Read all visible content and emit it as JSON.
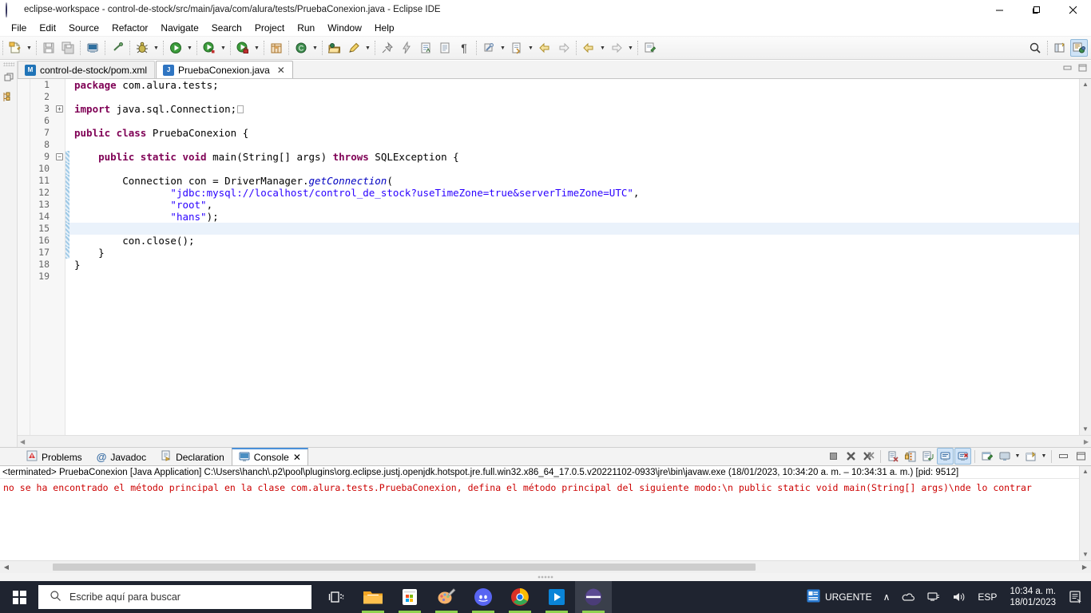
{
  "window": {
    "title": "eclipse-workspace - control-de-stock/src/main/java/com/alura/tests/PruebaConexion.java - Eclipse IDE",
    "app_icon": "eclipse-icon",
    "minimize": "—",
    "maximize": "❐",
    "close": "✕"
  },
  "menubar": {
    "items": [
      {
        "label": "File"
      },
      {
        "label": "Edit"
      },
      {
        "label": "Source"
      },
      {
        "label": "Refactor"
      },
      {
        "label": "Navigate"
      },
      {
        "label": "Search"
      },
      {
        "label": "Project"
      },
      {
        "label": "Run"
      },
      {
        "label": "Window"
      },
      {
        "label": "Help"
      }
    ]
  },
  "toolbar": {
    "buttons": [
      {
        "name": "new-wizard",
        "icon": "new-file-icon",
        "dropdown": true
      },
      {
        "name": "save",
        "icon": "save-icon",
        "dropdown": false
      },
      {
        "name": "save-all",
        "icon": "save-all-icon",
        "dropdown": false
      },
      {
        "name": "print",
        "icon": "print-icon",
        "dropdown": false
      },
      {
        "name": "link",
        "icon": "link-icon",
        "dropdown": false
      },
      {
        "name": "debug",
        "icon": "debug-bug-icon",
        "dropdown": true
      },
      {
        "name": "run",
        "icon": "run-play-icon",
        "dropdown": true
      },
      {
        "name": "coverage",
        "icon": "coverage-icon",
        "dropdown": true
      },
      {
        "name": "profile",
        "icon": "profile-lock-icon",
        "dropdown": true
      },
      {
        "name": "new-java-package",
        "icon": "package-icon",
        "dropdown": false
      },
      {
        "name": "new-class",
        "icon": "new-class-icon",
        "dropdown": true
      },
      {
        "name": "open-type",
        "icon": "open-type-icon",
        "dropdown": false
      },
      {
        "name": "search-pencil",
        "icon": "pencil-icon",
        "dropdown": true
      },
      {
        "name": "pin-editor",
        "icon": "pin-icon",
        "dropdown": false
      },
      {
        "name": "quick-fix",
        "icon": "lightning-icon",
        "dropdown": false
      },
      {
        "name": "toggle-markoccurrences",
        "icon": "document-a-icon",
        "dropdown": false
      },
      {
        "name": "show-whitespace",
        "icon": "document-icon",
        "dropdown": false
      },
      {
        "name": "paragraph-marks",
        "icon": "pilcrow-icon",
        "dropdown": false
      },
      {
        "name": "external-tools",
        "icon": "external-tools-icon",
        "dropdown": true
      },
      {
        "name": "next-annotation",
        "icon": "next-annotation-icon",
        "dropdown": true
      },
      {
        "name": "back",
        "icon": "back-arrow-icon",
        "dropdown": false
      },
      {
        "name": "forward",
        "icon": "forward-arrow-icon",
        "dropdown": false
      },
      {
        "name": "back-history",
        "icon": "back-arrow-yellow-icon",
        "dropdown": true
      },
      {
        "name": "forward-history",
        "icon": "forward-arrow-icon",
        "dropdown": true
      },
      {
        "name": "new-editor",
        "icon": "new-editor-icon",
        "dropdown": false
      }
    ],
    "right": [
      {
        "name": "quick-access-search",
        "icon": "search-icon"
      },
      {
        "name": "open-perspective",
        "icon": "open-perspective-icon"
      },
      {
        "name": "java-perspective",
        "icon": "java-perspective-icon",
        "active": true
      }
    ]
  },
  "leftbar": {
    "icons": [
      {
        "name": "restore-view-icon",
        "glyph": "❐"
      },
      {
        "name": "package-explorer-icon",
        "glyph": "▦"
      }
    ]
  },
  "editor": {
    "tabs": [
      {
        "label": "control-de-stock/pom.xml",
        "icon": "maven-icon",
        "icon_letter": "M",
        "active": false,
        "closable": false
      },
      {
        "label": "PruebaConexion.java",
        "icon": "java-file-icon",
        "icon_letter": "J",
        "active": true,
        "closable": true,
        "close_glyph": "✕"
      }
    ],
    "tab_controls": [
      {
        "name": "minimize-editor-icon",
        "glyph": "━"
      },
      {
        "name": "maximize-editor-icon",
        "glyph": "☐"
      }
    ],
    "lines": [
      {
        "num": "1",
        "fold": null,
        "current": false,
        "method_bar": false,
        "tokens": [
          {
            "t": "kw",
            "v": "package"
          },
          {
            "t": "plain",
            "v": " com.alura.tests;"
          }
        ]
      },
      {
        "num": "2",
        "fold": null,
        "current": false,
        "method_bar": false,
        "tokens": [
          {
            "t": "plain",
            "v": ""
          }
        ]
      },
      {
        "num": "3",
        "fold": "plus",
        "current": false,
        "method_bar": false,
        "tokens": [
          {
            "t": "kw",
            "v": "import"
          },
          {
            "t": "plain",
            "v": " java.sql.Connection;"
          },
          {
            "t": "boxed",
            "v": "·"
          }
        ]
      },
      {
        "num": "6",
        "fold": null,
        "current": false,
        "method_bar": false,
        "tokens": [
          {
            "t": "plain",
            "v": ""
          }
        ]
      },
      {
        "num": "7",
        "fold": null,
        "current": false,
        "method_bar": false,
        "tokens": [
          {
            "t": "kw",
            "v": "public class"
          },
          {
            "t": "plain",
            "v": " PruebaConexion {"
          }
        ]
      },
      {
        "num": "8",
        "fold": null,
        "current": false,
        "method_bar": false,
        "tokens": [
          {
            "t": "plain",
            "v": ""
          }
        ]
      },
      {
        "num": "9",
        "fold": "minus",
        "current": false,
        "method_bar": true,
        "tokens": [
          {
            "t": "plain",
            "v": "    "
          },
          {
            "t": "kw",
            "v": "public static void"
          },
          {
            "t": "plain",
            "v": " main(String[] args) "
          },
          {
            "t": "kw",
            "v": "throws"
          },
          {
            "t": "plain",
            "v": " SQLException {"
          }
        ]
      },
      {
        "num": "10",
        "fold": null,
        "current": false,
        "method_bar": true,
        "tokens": [
          {
            "t": "plain",
            "v": ""
          }
        ]
      },
      {
        "num": "11",
        "fold": null,
        "current": false,
        "method_bar": true,
        "tokens": [
          {
            "t": "plain",
            "v": "        Connection con = DriverManager."
          },
          {
            "t": "stat",
            "v": "getConnection"
          },
          {
            "t": "plain",
            "v": "("
          }
        ]
      },
      {
        "num": "12",
        "fold": null,
        "current": false,
        "method_bar": true,
        "tokens": [
          {
            "t": "plain",
            "v": "                "
          },
          {
            "t": "str",
            "v": "\"jdbc:mysql://localhost/control_de_stock?useTimeZone=true&serverTimeZone=UTC\""
          },
          {
            "t": "plain",
            "v": ","
          }
        ]
      },
      {
        "num": "13",
        "fold": null,
        "current": false,
        "method_bar": true,
        "tokens": [
          {
            "t": "plain",
            "v": "                "
          },
          {
            "t": "str",
            "v": "\"root\""
          },
          {
            "t": "plain",
            "v": ","
          }
        ]
      },
      {
        "num": "14",
        "fold": null,
        "current": false,
        "method_bar": true,
        "tokens": [
          {
            "t": "plain",
            "v": "                "
          },
          {
            "t": "str",
            "v": "\"hans\""
          },
          {
            "t": "plain",
            "v": ");"
          }
        ]
      },
      {
        "num": "15",
        "fold": null,
        "current": true,
        "method_bar": true,
        "tokens": [
          {
            "t": "plain",
            "v": ""
          }
        ]
      },
      {
        "num": "16",
        "fold": null,
        "current": false,
        "method_bar": true,
        "tokens": [
          {
            "t": "plain",
            "v": "        con.close();"
          }
        ]
      },
      {
        "num": "17",
        "fold": null,
        "current": false,
        "method_bar": true,
        "tokens": [
          {
            "t": "plain",
            "v": "    }"
          }
        ]
      },
      {
        "num": "18",
        "fold": null,
        "current": false,
        "method_bar": false,
        "tokens": [
          {
            "t": "plain",
            "v": "}"
          }
        ]
      },
      {
        "num": "19",
        "fold": null,
        "current": false,
        "method_bar": false,
        "tokens": [
          {
            "t": "plain",
            "v": ""
          }
        ]
      }
    ]
  },
  "console": {
    "tabs": [
      {
        "label": "Problems",
        "icon": "problems-icon",
        "active": false,
        "closable": false
      },
      {
        "label": "Javadoc",
        "icon": "javadoc-at-icon",
        "active": false,
        "closable": false
      },
      {
        "label": "Declaration",
        "icon": "declaration-icon",
        "active": false,
        "closable": false
      },
      {
        "label": "Console",
        "icon": "console-icon",
        "active": true,
        "closable": true,
        "close_glyph": "✕"
      }
    ],
    "toolbar": [
      {
        "name": "terminate-button",
        "icon": "stop-square-icon",
        "active": false
      },
      {
        "name": "remove-launch-button",
        "icon": "remove-x-icon",
        "active": false
      },
      {
        "name": "remove-all-terminated-button",
        "icon": "remove-all-x-icon",
        "active": false
      },
      {
        "name": "clear-console-button",
        "icon": "clear-console-icon",
        "active": false
      },
      {
        "name": "scroll-lock-button",
        "icon": "scroll-lock-icon",
        "active": false
      },
      {
        "name": "word-wrap-button",
        "icon": "word-wrap-icon",
        "active": false
      },
      {
        "name": "show-console-on-output-button",
        "icon": "show-stdout-icon",
        "active": true
      },
      {
        "name": "show-console-on-error-button",
        "icon": "show-stderr-icon",
        "active": true
      },
      {
        "name": "pin-console-button",
        "icon": "pin-console-icon",
        "active": false
      },
      {
        "name": "display-selected-console-button",
        "icon": "display-console-icon",
        "active": false,
        "dropdown": true
      },
      {
        "name": "open-console-button",
        "icon": "open-console-icon",
        "active": false,
        "dropdown": true
      },
      {
        "name": "minimize-panel-button",
        "icon": "minimize-icon",
        "active": false
      },
      {
        "name": "maximize-panel-button",
        "icon": "maximize-icon",
        "active": false
      }
    ],
    "launch_header": "<terminated> PruebaConexion [Java Application] C:\\Users\\hanch\\.p2\\pool\\plugins\\org.eclipse.justj.openjdk.hotspot.jre.full.win32.x86_64_17.0.5.v20221102-0933\\jre\\bin\\javaw.exe  (18/01/2023, 10:34:20 a. m. – 10:34:31 a. m.) [pid: 9512]",
    "output": "no se ha encontrado el método principal en la clase com.alura.tests.PruebaConexion, defina el método principal del siguiente modo:\\n   public static void main(String[] args)\\nde lo contrar",
    "output_color": "#cc0000"
  },
  "taskbar": {
    "start_label": "start-button",
    "search_placeholder": "Escribe aquí para buscar",
    "apps": [
      {
        "name": "task-view-icon",
        "running": false
      },
      {
        "name": "file-explorer-icon",
        "running": true
      },
      {
        "name": "microsoft-store-icon",
        "running": true
      },
      {
        "name": "paint-3d-icon",
        "running": true
      },
      {
        "name": "discord-icon",
        "running": true
      },
      {
        "name": "google-chrome-icon",
        "running": true
      },
      {
        "name": "movies-tv-icon",
        "running": true
      },
      {
        "name": "eclipse-icon",
        "running": true,
        "active": true
      }
    ],
    "tray": {
      "urgente_label": "URGENTE",
      "chevron": "∧",
      "icons": [
        {
          "name": "onedrive-icon"
        },
        {
          "name": "network-icon"
        },
        {
          "name": "volume-icon"
        }
      ],
      "language": "ESP",
      "time": "10:34 a. m.",
      "date": "18/01/2023",
      "action_center": "notifications-icon"
    }
  },
  "colors": {
    "accent": "#4a90d9",
    "keyword": "#7f0055",
    "string": "#2a00ff",
    "static_method": "#0000c0",
    "error": "#cc0000",
    "taskbar_bg": "#1f2430",
    "selected_line": "#eaf2fb"
  }
}
